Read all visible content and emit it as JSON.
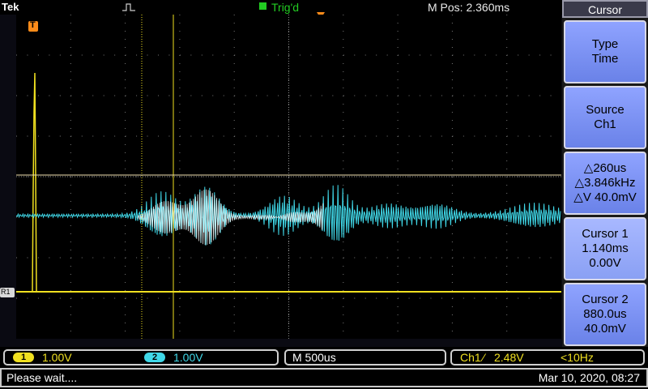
{
  "header": {
    "brand": "Tek",
    "trigger_status": "Trig'd",
    "m_pos": "M Pos: 2.360ms",
    "colors": {
      "trig_green": "#22cc22",
      "marker_orange": "#ff8c1a"
    }
  },
  "markers": {
    "trigger_marker_letter": "T",
    "reference_label": "R1"
  },
  "menu": {
    "title": "Cursor",
    "buttons": [
      {
        "lines": [
          "Type",
          "Time"
        ]
      },
      {
        "lines": [
          "Source",
          "Ch1"
        ]
      },
      {
        "lines": [
          "△260us",
          "△3.846kHz",
          "△V 40.0mV"
        ]
      },
      {
        "lines": [
          "Cursor 1",
          "1.140ms",
          "0.00V"
        ]
      },
      {
        "lines": [
          "Cursor 2",
          "880.0us",
          "40.0mV"
        ]
      }
    ]
  },
  "readouts": {
    "ch1": {
      "chip": "1",
      "scale": "1.00V",
      "color": "#f0e020"
    },
    "ch2": {
      "chip": "2",
      "scale": "1.00V",
      "color": "#40d8e8"
    },
    "timebase": "M 500us",
    "trigger": {
      "source": "Ch1",
      "slope": "⁄",
      "level": "2.48V",
      "freq": "<10Hz"
    }
  },
  "status": {
    "message": "Please wait....",
    "datetime": "Mar 10, 2020, 08:27"
  }
}
